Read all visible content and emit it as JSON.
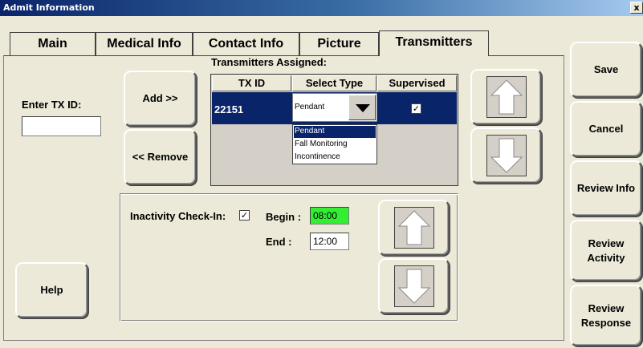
{
  "window": {
    "title": "Admit Information",
    "close_label": "x"
  },
  "tabs": [
    {
      "label": "Main"
    },
    {
      "label": "Medical Info"
    },
    {
      "label": "Contact Info"
    },
    {
      "label": "Picture"
    },
    {
      "label": "Transmitters",
      "active": true
    }
  ],
  "enter_tx": {
    "label": "Enter TX ID:",
    "value": ""
  },
  "buttons": {
    "add": "Add >>",
    "remove": "<< Remove",
    "help": "Help"
  },
  "transmitters": {
    "section_title": "Transmitters Assigned:",
    "columns": [
      "TX ID",
      "Select Type",
      "Supervised"
    ],
    "rows": [
      {
        "tx_id": "22151",
        "type": "Pendant",
        "supervised": true
      }
    ],
    "type_options": [
      "Pendant",
      "Fall Monitoring",
      "Incontinence"
    ],
    "selected_option": "Pendant"
  },
  "inactivity": {
    "label": "Inactivity Check-In:",
    "checked": true,
    "begin_label": "Begin :",
    "begin_value": "08:00",
    "end_label": "End :",
    "end_value": "12:00"
  },
  "side_buttons": {
    "save": "Save",
    "cancel": "Cancel",
    "review_info": "Review Info",
    "review_activity": "Review Activity",
    "review_response": "Review Response"
  },
  "colors": {
    "titlebar_start": "#0a246a",
    "selection": "#0a246a",
    "begin_time_bg": "#33ee33",
    "face": "#ece9d8"
  },
  "icons": {
    "move_up": "up-arrow-icon",
    "move_down": "down-arrow-icon",
    "dropdown": "triangle-down-icon",
    "checkbox": "checkmark-icon"
  }
}
